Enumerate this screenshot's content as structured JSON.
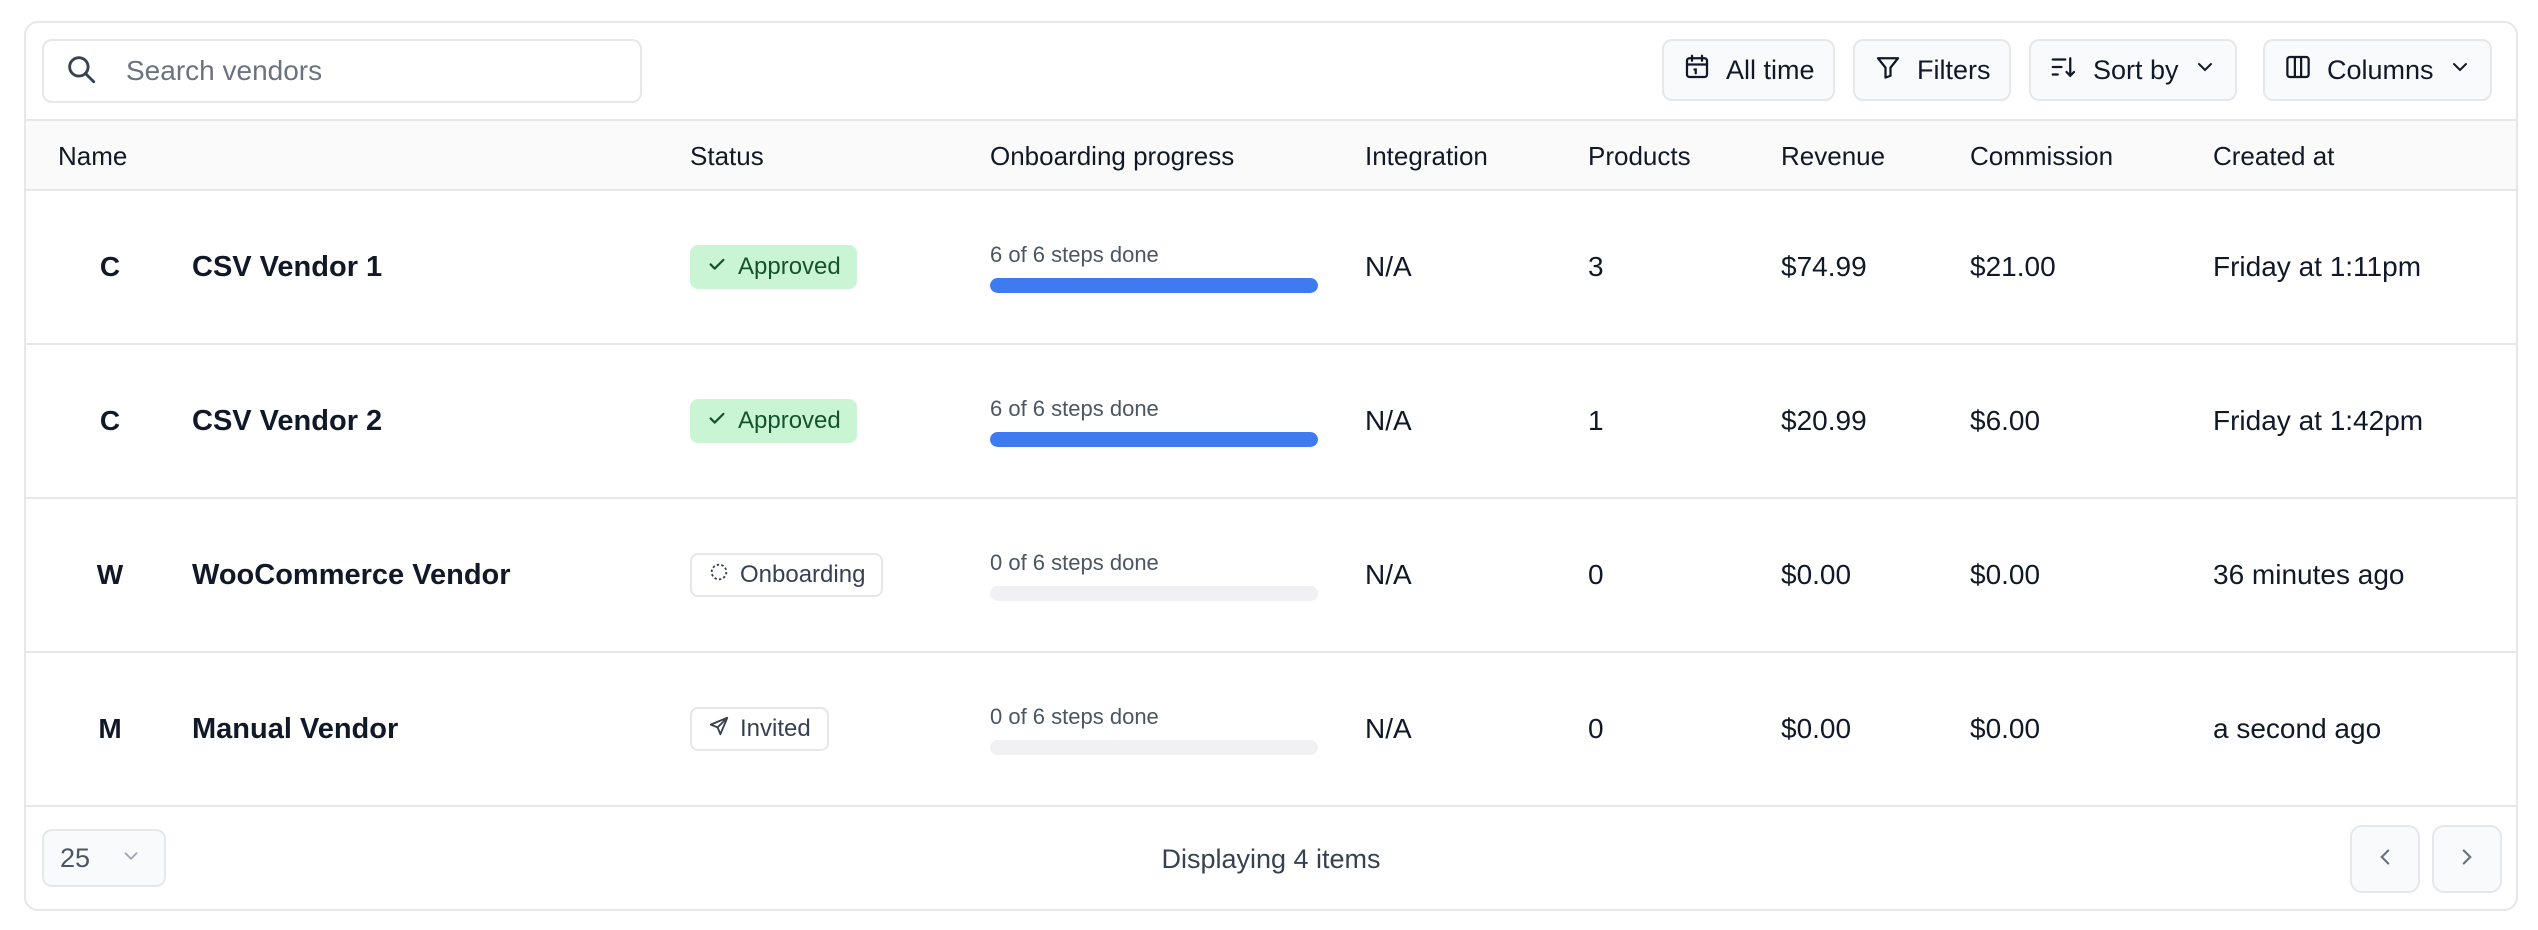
{
  "toolbar": {
    "search_placeholder": "Search vendors",
    "date_label": "All time",
    "filters_label": "Filters",
    "sort_label": "Sort by",
    "columns_label": "Columns"
  },
  "table": {
    "headers": [
      "Name",
      "Status",
      "Onboarding progress",
      "Integration",
      "Products",
      "Revenue",
      "Commission",
      "Created at"
    ],
    "rows": [
      {
        "initial": "C",
        "name": "CSV Vendor 1",
        "status": "Approved",
        "status_icon": "check-icon",
        "progress_label": "6 of 6 steps done",
        "progress": 1.0,
        "integration": "N/A",
        "products": "3",
        "revenue": "$74.99",
        "commission": "$21.00",
        "created": "Friday at 1:11pm"
      },
      {
        "initial": "C",
        "name": "CSV Vendor 2",
        "status": "Approved",
        "status_icon": "check-icon",
        "progress_label": "6 of 6 steps done",
        "progress": 1.0,
        "integration": "N/A",
        "products": "1",
        "revenue": "$20.99",
        "commission": "$6.00",
        "created": "Friday at 1:42pm"
      },
      {
        "initial": "W",
        "name": "WooCommerce Vendor",
        "status": "Onboarding",
        "status_icon": "dashed-circle-icon",
        "progress_label": "0 of 6 steps done",
        "progress": 0.0,
        "integration": "N/A",
        "products": "0",
        "revenue": "$0.00",
        "commission": "$0.00",
        "created": "36 minutes ago"
      },
      {
        "initial": "M",
        "name": "Manual Vendor",
        "status": "Invited",
        "status_icon": "send-icon",
        "progress_label": "0 of 6 steps done",
        "progress": 0.0,
        "integration": "N/A",
        "products": "0",
        "revenue": "$0.00",
        "commission": "$0.00",
        "created": "a second ago"
      }
    ]
  },
  "footer": {
    "page_size": "25",
    "display_text": "Displaying 4 items"
  },
  "colors": {
    "accent": "#3e7bf0",
    "approved_bg": "#c9f5d5",
    "approved_text": "#14532d",
    "border": "#e5e7eb"
  }
}
